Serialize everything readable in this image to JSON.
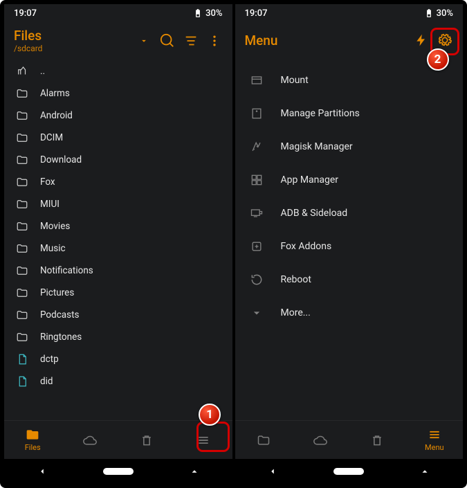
{
  "status": {
    "time": "19:07",
    "battery": "30%"
  },
  "left": {
    "title": "Files",
    "subtitle": "/sdcard",
    "items": [
      {
        "label": "..",
        "type": "up"
      },
      {
        "label": "Alarms",
        "type": "folder"
      },
      {
        "label": "Android",
        "type": "folder"
      },
      {
        "label": "DCIM",
        "type": "folder"
      },
      {
        "label": "Download",
        "type": "folder"
      },
      {
        "label": "Fox",
        "type": "folder"
      },
      {
        "label": "MIUI",
        "type": "folder"
      },
      {
        "label": "Movies",
        "type": "folder"
      },
      {
        "label": "Music",
        "type": "folder"
      },
      {
        "label": "Notifications",
        "type": "folder"
      },
      {
        "label": "Pictures",
        "type": "folder"
      },
      {
        "label": "Podcasts",
        "type": "folder"
      },
      {
        "label": "Ringtones",
        "type": "folder"
      },
      {
        "label": "dctp",
        "type": "file"
      },
      {
        "label": "did",
        "type": "file"
      }
    ],
    "nav": {
      "files": "Files"
    }
  },
  "right": {
    "title": "Menu",
    "items": [
      {
        "label": "Mount"
      },
      {
        "label": "Manage Partitions"
      },
      {
        "label": "Magisk Manager"
      },
      {
        "label": "App Manager"
      },
      {
        "label": "ADB & Sideload"
      },
      {
        "label": "Fox Addons"
      },
      {
        "label": "Reboot"
      },
      {
        "label": "More..."
      }
    ],
    "nav": {
      "menu": "Menu"
    }
  },
  "callouts": {
    "one": "1",
    "two": "2"
  }
}
